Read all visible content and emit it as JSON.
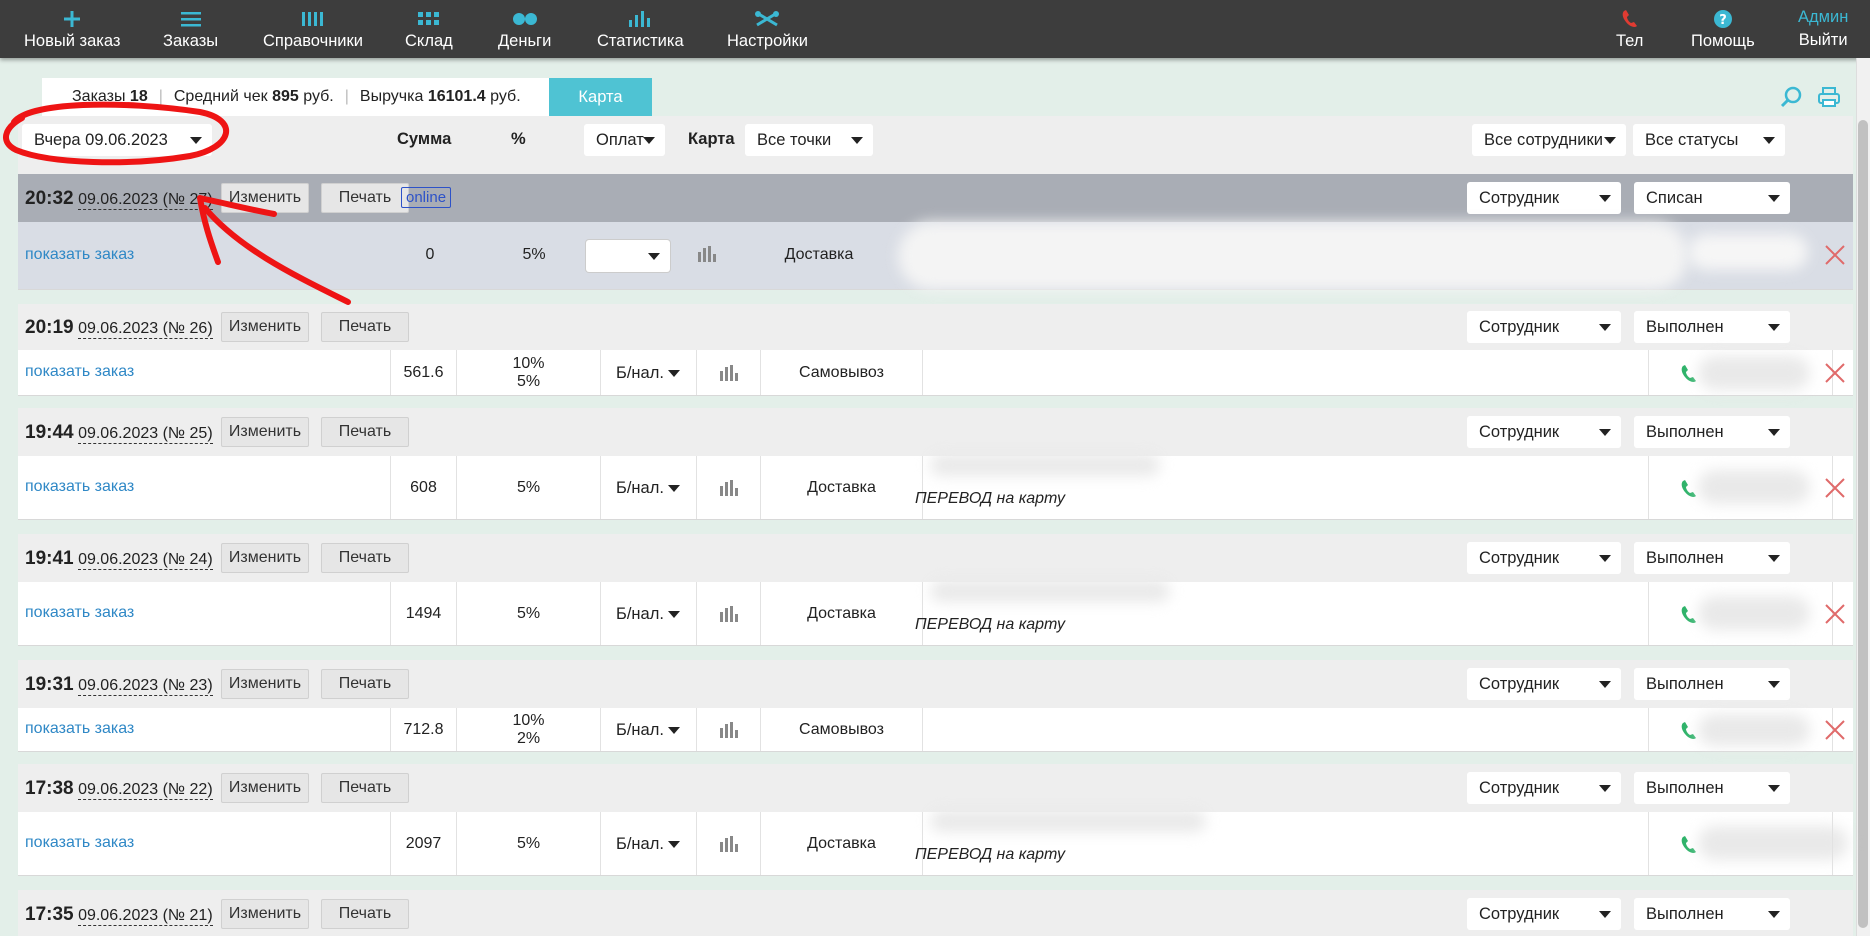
{
  "nav": {
    "new_order": "Новый заказ",
    "orders": "Заказы",
    "references": "Справочники",
    "warehouse": "Склад",
    "money": "Деньги",
    "stats": "Статистика",
    "settings": "Настройки",
    "phone": "Тел",
    "help": "Помощь",
    "user": "Админ",
    "logout": "Выйти"
  },
  "summary": {
    "orders_label": "Заказы",
    "orders_count": "18",
    "avg_label": "Средний чек",
    "avg_value": "895",
    "avg_unit": "руб.",
    "revenue_label": "Выручка",
    "revenue_value": "16101.4",
    "revenue_unit": "руб.",
    "map_tab": "Карта"
  },
  "filters": {
    "date": "Вчера 09.06.2023",
    "sum_header": "Сумма",
    "pct_header": "%",
    "payment": "Оплат",
    "map_label": "Карта",
    "points": "Все точки",
    "employees": "Все сотрудники",
    "statuses": "Все статусы"
  },
  "labels": {
    "edit": "Изменить",
    "print": "Печать",
    "show_order": "показать заказ",
    "employee": "Сотрудник",
    "online": "online"
  },
  "orders": [
    {
      "time": "20:32",
      "date": "09.06.2023 (№ 27)",
      "online": true,
      "status": "Списан",
      "sum": "0",
      "pct1": "5%",
      "pct2": "",
      "payment": "",
      "delivery": "Доставка",
      "note": ""
    },
    {
      "time": "20:19",
      "date": "09.06.2023 (№ 26)",
      "online": false,
      "status": "Выполнен",
      "sum": "561.6",
      "pct1": "10%",
      "pct2": "5%",
      "payment": "Б/нал.",
      "delivery": "Самовывоз",
      "note": ""
    },
    {
      "time": "19:44",
      "date": "09.06.2023 (№ 25)",
      "online": false,
      "status": "Выполнен",
      "sum": "608",
      "pct1": "5%",
      "pct2": "",
      "payment": "Б/нал.",
      "delivery": "Доставка",
      "note": "ПЕРЕВОД на карту"
    },
    {
      "time": "19:41",
      "date": "09.06.2023 (№ 24)",
      "online": false,
      "status": "Выполнен",
      "sum": "1494",
      "pct1": "5%",
      "pct2": "",
      "payment": "Б/нал.",
      "delivery": "Доставка",
      "note": "ПЕРЕВОД на карту"
    },
    {
      "time": "19:31",
      "date": "09.06.2023 (№ 23)",
      "online": false,
      "status": "Выполнен",
      "sum": "712.8",
      "pct1": "10%",
      "pct2": "2%",
      "payment": "Б/нал.",
      "delivery": "Самовывоз",
      "note": ""
    },
    {
      "time": "17:38",
      "date": "09.06.2023 (№ 22)",
      "online": false,
      "status": "Выполнен",
      "sum": "2097",
      "pct1": "5%",
      "pct2": "",
      "payment": "Б/нал.",
      "delivery": "Доставка",
      "note": "ПЕРЕВОД на карту"
    },
    {
      "time": "17:35",
      "date": "09.06.2023 (№ 21)",
      "online": false,
      "status": "Выполнен"
    }
  ]
}
